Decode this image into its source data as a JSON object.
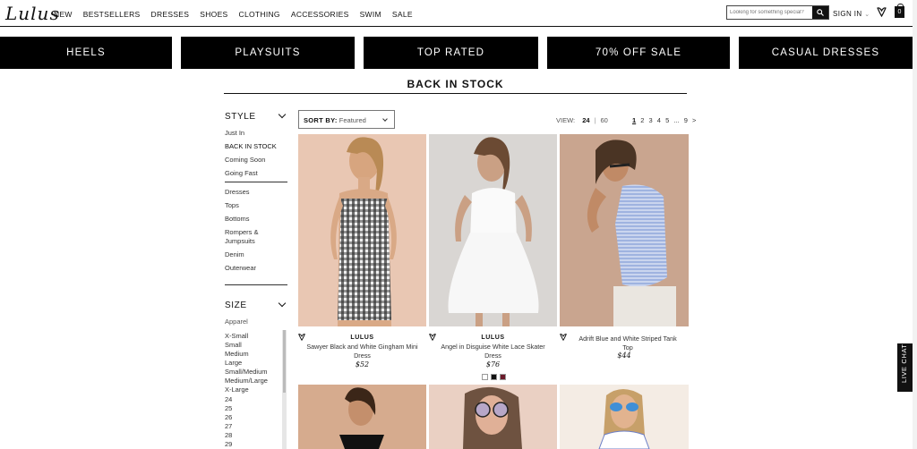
{
  "header": {
    "logo": "Lulus",
    "nav": [
      "NEW",
      "BESTSELLERS",
      "DRESSES",
      "SHOES",
      "CLOTHING",
      "ACCESSORIES",
      "SWIM",
      "SALE"
    ],
    "search_placeholder": "Looking for something special?",
    "search_icon": "search-icon",
    "signin_label": "SIGN IN",
    "signin_chevron": "chevron-down-icon",
    "wishlist_icon": "heart-icon",
    "bag_icon": "shopping-bag-icon",
    "bag_count": "0"
  },
  "banners": [
    "HEELS",
    "PLAYSUITS",
    "TOP RATED",
    "70% OFF SALE",
    "CASUAL DRESSES"
  ],
  "page_title": "BACK IN STOCK",
  "sidebar": {
    "style_heading": "STYLE",
    "status_items": [
      "Just In",
      "BACK IN STOCK",
      "Coming Soon",
      "Going Fast"
    ],
    "category_items": [
      "Dresses",
      "Tops",
      "Bottoms",
      "Rompers &",
      "Jumpsuits",
      "Denim",
      "Outerwear"
    ],
    "size_heading": "SIZE",
    "size_group_label": "Apparel",
    "size_items": [
      "X-Small",
      "Small",
      "Medium",
      "Large",
      "Small/Medium",
      "Medium/Large",
      "X-Large",
      "24",
      "25",
      "26",
      "27",
      "28",
      "29"
    ]
  },
  "toolbar": {
    "sort_label": "SORT BY:",
    "sort_value": "Featured",
    "view_label": "VIEW:",
    "view_options": [
      "24",
      "60"
    ],
    "pages": [
      "1",
      "2",
      "3",
      "4",
      "5",
      "...",
      "9",
      ">"
    ]
  },
  "products": [
    {
      "brand": "LULUS",
      "name_line1": "Sawyer Black and White Gingham Mini",
      "name_line2": "Dress",
      "price": "$52"
    },
    {
      "brand": "LULUS",
      "name_line1": "Angel in Disguise White Lace Skater",
      "name_line2": "Dress",
      "price": "$76"
    },
    {
      "brand": "",
      "name_line1": "Adrift Blue and White Striped Tank",
      "name_line2": "Top",
      "price": "$44"
    }
  ],
  "swatch_colors": [
    "#ffffff",
    "#111111",
    "#6b1a2a"
  ],
  "live_chat_label": "LIVE CHAT",
  "colors": {
    "accent": "#000000",
    "text": "#111111",
    "muted": "#555555"
  }
}
